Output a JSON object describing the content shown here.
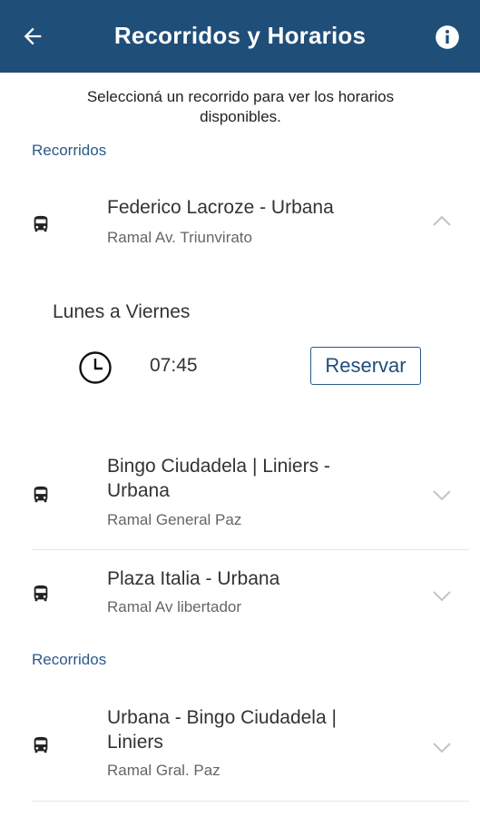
{
  "header": {
    "title": "Recorridos y Horarios",
    "back_icon": "arrow-left-icon",
    "info_icon": "info-icon",
    "background_color": "#1f4e79"
  },
  "intro": {
    "line1": "Seleccioná un recorrido para ver los horarios",
    "line2": "disponibles."
  },
  "sections": [
    {
      "label": "Recorridos",
      "routes": [
        {
          "name": "Federico Lacroze - Urbana",
          "branch": "Ramal Av. Triunvirato",
          "expanded": true,
          "schedule": {
            "day_label": "Lunes a Viernes",
            "times": [
              {
                "time": "07:45",
                "action_label": "Reservar"
              }
            ]
          }
        },
        {
          "name_line1": "Bingo Ciudadela | Liniers -",
          "name_line2": "Urbana",
          "branch": "Ramal General Paz",
          "expanded": false
        },
        {
          "name": "Plaza Italia - Urbana",
          "branch": "Ramal Av libertador",
          "expanded": false
        }
      ]
    },
    {
      "label": "Recorridos",
      "routes": [
        {
          "name_line1": "Urbana - Bingo Ciudadela |",
          "name_line2": "Liniers",
          "branch": "Ramal Gral. Paz",
          "expanded": false
        }
      ]
    }
  ],
  "colors": {
    "accent": "#2a5a88",
    "text": "#333333",
    "muted": "#666666"
  }
}
